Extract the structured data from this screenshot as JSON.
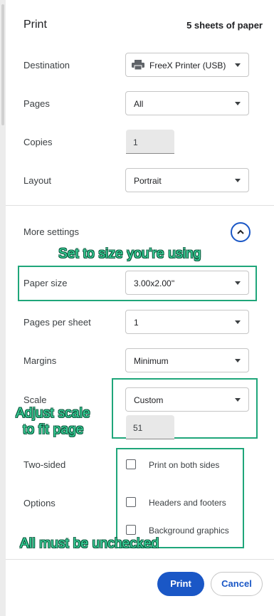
{
  "header": {
    "title": "Print",
    "sheets": "5 sheets of paper"
  },
  "destination": {
    "label": "Destination",
    "value": "FreeX Printer (USB)"
  },
  "pages": {
    "label": "Pages",
    "value": "All"
  },
  "copies": {
    "label": "Copies",
    "value": "1"
  },
  "layout": {
    "label": "Layout",
    "value": "Portrait"
  },
  "more_settings": {
    "label": "More settings"
  },
  "paper_size": {
    "label": "Paper size",
    "value": "3.00x2.00''"
  },
  "pages_per_sheet": {
    "label": "Pages per sheet",
    "value": "1"
  },
  "margins": {
    "label": "Margins",
    "value": "Minimum"
  },
  "scale": {
    "label": "Scale",
    "value": "Custom",
    "custom_value": "51"
  },
  "two_sided": {
    "label": "Two-sided",
    "option": "Print on both sides",
    "checked": false
  },
  "options": {
    "label": "Options",
    "headers_footers": "Headers and footers",
    "background_graphics": "Background graphics"
  },
  "annotations": {
    "paper_size_note": "Set to size you're using",
    "scale_note_line1": "Adjust scale",
    "scale_note_line2": "to fit page",
    "checkbox_note": "All must be unchecked"
  },
  "footer": {
    "print_label": "Print",
    "cancel_label": "Cancel"
  },
  "colors": {
    "accent": "#1a57c6",
    "annotation": "#1fa67a"
  }
}
